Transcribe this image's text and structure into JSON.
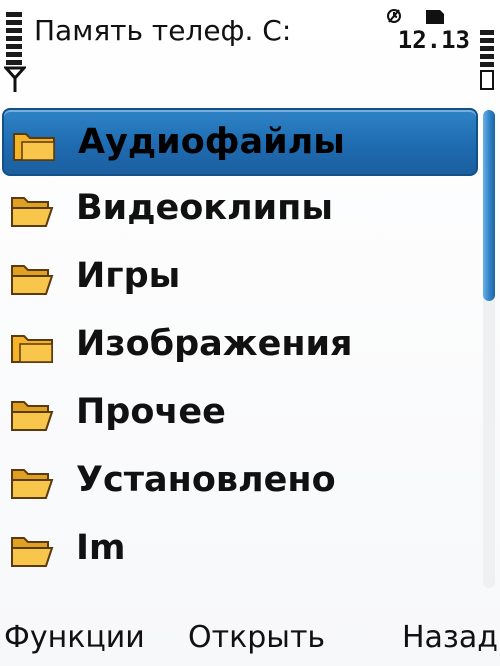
{
  "status": {
    "title": "Память телеф. C:",
    "clock": "12.13",
    "signal_level": 7,
    "battery_level": 7
  },
  "files": {
    "selected_index": 0,
    "items": [
      {
        "label": "Аудиофайлы",
        "icon": "folder-closed-icon"
      },
      {
        "label": "Видеоклипы",
        "icon": "folder-open-icon"
      },
      {
        "label": "Игры",
        "icon": "folder-open-icon"
      },
      {
        "label": "Изображения",
        "icon": "folder-closed-icon"
      },
      {
        "label": "Прочее",
        "icon": "folder-open-icon"
      },
      {
        "label": "Установлено",
        "icon": "folder-open-icon"
      },
      {
        "label": "Im",
        "icon": "folder-open-icon"
      }
    ]
  },
  "scrollbar": {
    "thumb_fraction": 0.4
  },
  "softkeys": {
    "left": "Функции",
    "center": "Открыть",
    "right": "Назад"
  },
  "colors": {
    "selection": "#1f6bb1",
    "folder_fill": "#f5b428",
    "folder_outline": "#5a3a10"
  }
}
